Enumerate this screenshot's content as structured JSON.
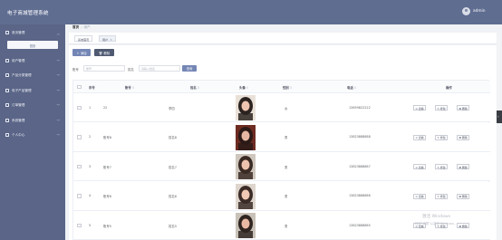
{
  "app": {
    "title": "电子商城管理系统",
    "user": "admin"
  },
  "sidebar": {
    "groups": [
      {
        "label": "首页管理",
        "icon": "home-icon",
        "expanded": true
      },
      {
        "label": "用户管理",
        "icon": "user-icon"
      },
      {
        "label": "产品分类管理",
        "icon": "category-icon"
      },
      {
        "label": "电子产品管理",
        "icon": "product-icon"
      },
      {
        "label": "订单管理",
        "icon": "order-icon"
      },
      {
        "label": "系统管理",
        "icon": "settings-icon"
      },
      {
        "label": "个人中心",
        "icon": "profile-icon"
      }
    ],
    "sub_item": "首页"
  },
  "breadcrumb": {
    "home": "首页",
    "current": "用户"
  },
  "tags": [
    {
      "label": "系统首页"
    },
    {
      "label": "用户",
      "close": "×"
    }
  ],
  "toolbar": {
    "add_label": "添加",
    "add_icon": "+",
    "delete_label": "删除",
    "delete_icon": "🗑"
  },
  "search": {
    "account_label": "账号",
    "account_placeholder": "账号",
    "name_label": "姓名",
    "name_placeholder": "请输入姓名",
    "query_label": "查询"
  },
  "table": {
    "headers": {
      "index": "序号",
      "account": "账号",
      "name": "姓名",
      "avatar": "头像",
      "gender": "性别",
      "phone": "电话",
      "ops": "操作"
    },
    "sort_icon": "⇕",
    "ops": {
      "view": "查看",
      "edit": "修改",
      "delete": "删除"
    },
    "rows": [
      {
        "index": "1",
        "account": "22",
        "name": "李四",
        "gender": "女",
        "phone": "13659822222"
      },
      {
        "index": "2",
        "account": "账号8",
        "name": "姓名8",
        "gender": "男",
        "phone": "13823888888"
      },
      {
        "index": "3",
        "account": "账号7",
        "name": "姓名7",
        "gender": "男",
        "phone": "13823888887"
      },
      {
        "index": "4",
        "account": "账号6",
        "name": "姓名6",
        "gender": "男",
        "phone": "13823888886"
      },
      {
        "index": "5",
        "account": "账号5",
        "name": "姓名5",
        "gender": "男",
        "phone": "13823888885"
      }
    ]
  },
  "watermark": {
    "line1": "激活 Windows",
    "line2": "转到\"设置\"以激活 Windows。"
  },
  "colors": {
    "topbar": "#5f6d91",
    "sidebar": "#5a6587",
    "accent": "#7486b5"
  }
}
